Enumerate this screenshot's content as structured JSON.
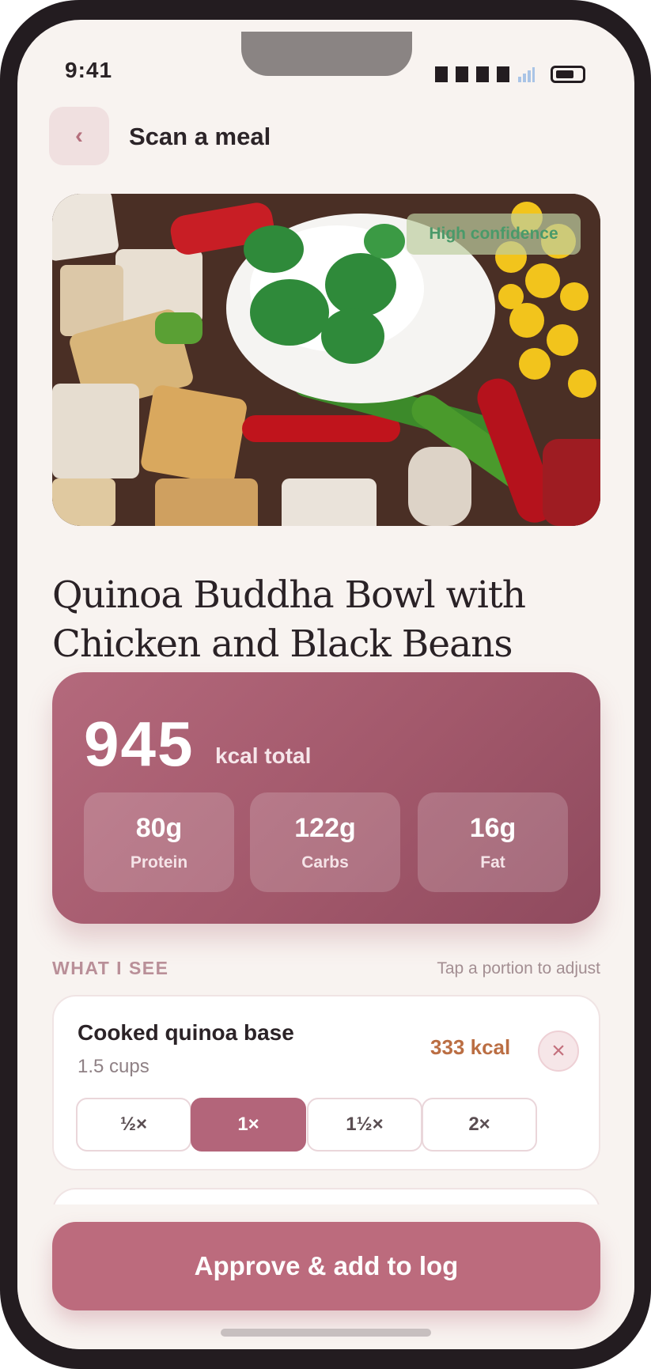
{
  "status_bar": {
    "time": "9:41"
  },
  "header": {
    "back_icon": "chevron-left-icon",
    "back_glyph": "‹",
    "title": "Scan a meal"
  },
  "photo": {
    "confidence_badge": "High confidence"
  },
  "meal": {
    "title": "Quinoa Buddha Bowl with Chicken and Black Beans"
  },
  "calories": {
    "total": "945",
    "label": "kcal total"
  },
  "macros": [
    {
      "value": "80g",
      "name": "Protein"
    },
    {
      "value": "122g",
      "name": "Carbs"
    },
    {
      "value": "16g",
      "name": "Fat"
    }
  ],
  "section": {
    "label": "WHAT I SEE",
    "hint": "Tap a portion to adjust"
  },
  "items": [
    {
      "name": "Cooked quinoa base",
      "quantity": "1.5 cups",
      "kcal": "333 kcal",
      "remove_glyph": "×",
      "portions": [
        "½×",
        "1×",
        "1½×",
        "2×"
      ],
      "selected_portion": "1×"
    }
  ],
  "actions": {
    "approve_label": "Approve & add to log"
  },
  "colors": {
    "background": "#f8f3f0",
    "accent": "#bc6b7d",
    "card_gradient_start": "#b4697c",
    "card_gradient_end": "#8f4a5e",
    "kcal_item": "#bb6e43",
    "confidence_text": "#4a9a6a"
  }
}
